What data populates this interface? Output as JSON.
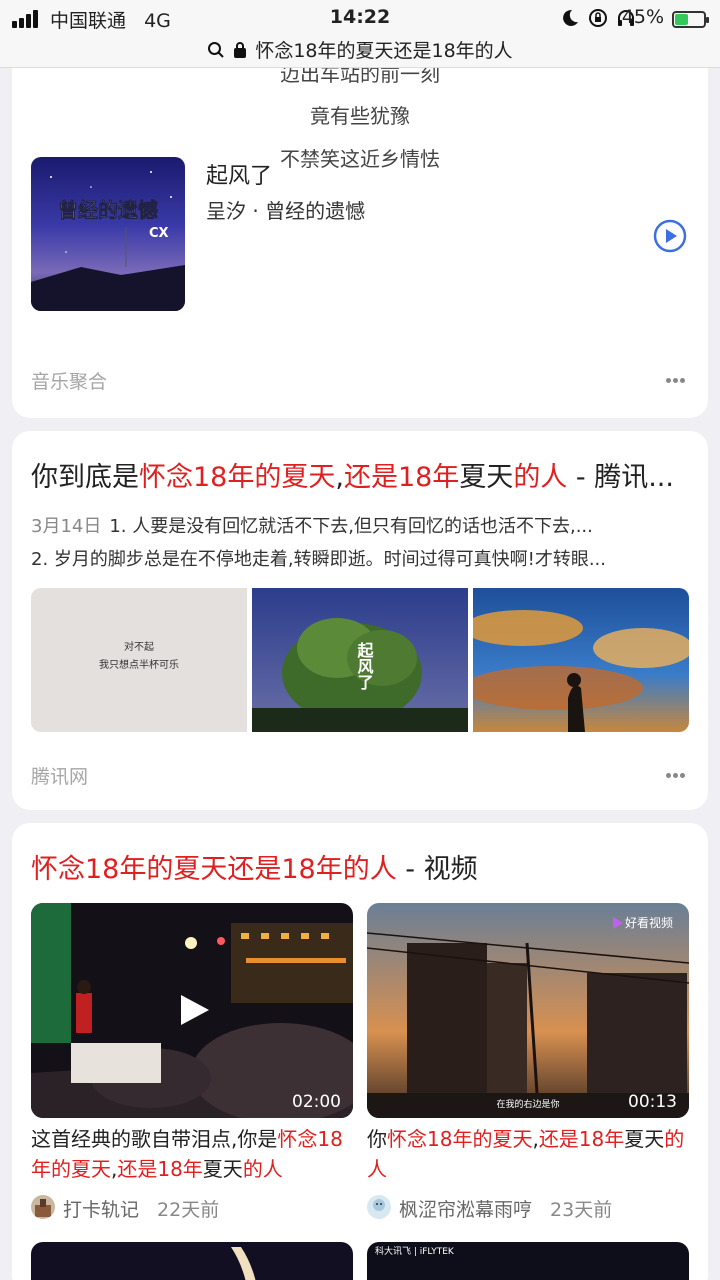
{
  "status_bar": {
    "carrier": "中国联通",
    "network": "4G",
    "time": "14:22",
    "battery": "45%",
    "battery_fraction": 0.45
  },
  "url_bar": {
    "title": "怀念18年的夏天还是18年的人"
  },
  "music_card": {
    "lyrics": [
      "迈出车站的前一刻",
      "竟有些犹豫",
      "不禁笑这近乡情怯"
    ],
    "album_art_text": "曾经的遗憾",
    "album_art_sub": "CX",
    "song": "起风了",
    "meta": "呈汐 · 曾经的遗憾",
    "source": "音乐聚合"
  },
  "result_card": {
    "title_parts": [
      "你到底是",
      "怀念18年的夏天",
      ",",
      "还是18年",
      "夏天",
      "的人",
      " - 腾讯..."
    ],
    "date": "3月14日",
    "snippet1": "1. 人要是没有回忆就活不下去,但只有回忆的话也活不下去,...",
    "snippet2": "2. 岁月的脚步总是在不停地走着,转瞬即逝。时间过得可真快啊!才转眼...",
    "thumb1_text_1": "对不起",
    "thumb1_text_2": "我只想点半杯可乐",
    "thumb2_text": "起风了",
    "source": "腾讯网"
  },
  "video_card": {
    "heading_red": "怀念18年的夏天还是18年的人",
    "heading_rest": " - 视频",
    "videos": [
      {
        "duration": "02:00",
        "title_parts": [
          "这首经典的歌自带泪点,你是",
          "怀念18年的夏天",
          ",",
          "还是18年",
          "夏天",
          "的人"
        ],
        "author": "打卡轨记",
        "ago": "22天前"
      },
      {
        "duration": "00:13",
        "watermark": "好看视频",
        "caption": "在我的右边是你",
        "title_parts": [
          "你",
          "怀念18年的夏天",
          ",",
          "还是18年",
          "夏天",
          "的人"
        ],
        "author": "枫涩帘淞幕雨哼",
        "ago": "23天前"
      }
    ],
    "next_thumb_text": "科大讯飞 | iFLYTEK"
  },
  "colors": {
    "highlight": "#e02020",
    "link_blue": "#3d6fe0",
    "muted": "#a6a6a6"
  }
}
